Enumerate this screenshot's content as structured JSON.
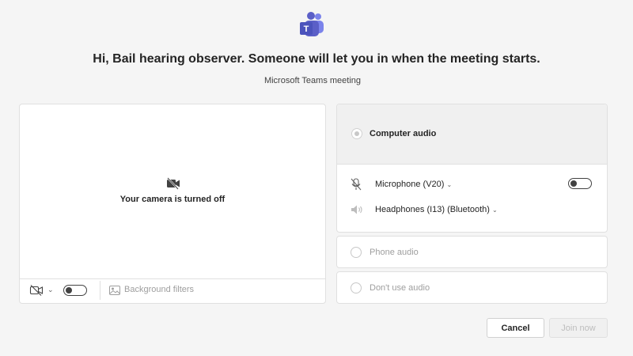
{
  "header": {
    "logo_letter": "T",
    "greeting": "Hi, Bail hearing observer. Someone will let you in when the meeting starts.",
    "meeting_type": "Microsoft Teams meeting"
  },
  "video": {
    "camera_off_icon": "video-off-icon",
    "camera_off_text": "Your camera is turned off",
    "camera_toggle_state": "off",
    "background_filters_label": "Background filters"
  },
  "audio": {
    "computer_audio_label": "Computer audio",
    "computer_audio_selected": true,
    "microphone_label": "Microphone (V20)",
    "microphone_toggle_state": "off",
    "speaker_label": "Headphones (I13) (Bluetooth)",
    "phone_audio_label": "Phone audio",
    "no_audio_label": "Don't use audio"
  },
  "actions": {
    "cancel_label": "Cancel",
    "join_label": "Join now"
  },
  "colors": {
    "brand": "#5b5fc7",
    "background": "#f5f5f5",
    "disabled_text": "#bdbdbd"
  }
}
